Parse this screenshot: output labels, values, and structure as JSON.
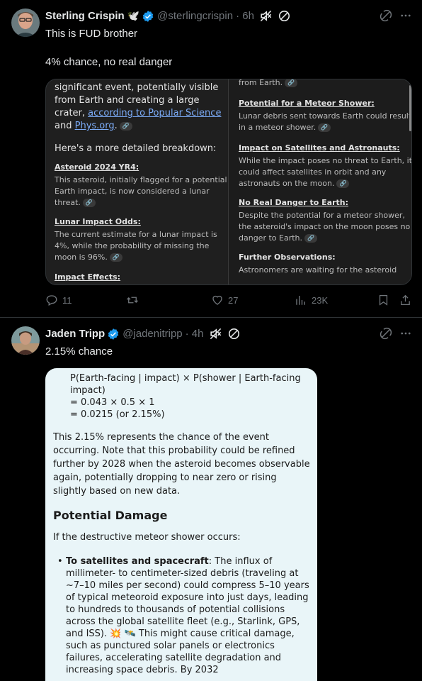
{
  "tweet1": {
    "name": "Sterling Crispin",
    "emoji": "🕊️",
    "handle": "@sterlingcrispin",
    "time": "· 6h",
    "text_line1": "This is FUD brother",
    "text_line2": "4% chance, no real danger",
    "media": {
      "left": {
        "lead_text": "significant event, potentially visible from Earth and creating a large crater,",
        "lead_link1": "according to Popular Science",
        "lead_and": " and",
        "lead_link2": "Phys.org",
        "lead_end": ".",
        "breakdown": "Here's a more detailed breakdown:",
        "s1_title": "Asteroid 2024 YR4:",
        "s1_text": "This asteroid, initially flagged for a potential Earth impact, is now considered a lunar threat.",
        "s2_title": "Lunar Impact Odds:",
        "s2_text": "The current estimate for a lunar impact is 4%, while the probability of missing the moon is 96%.",
        "s3_title": "Impact Effects:"
      },
      "right": {
        "top_text": "from Earth.",
        "r1_title": "Potential for a Meteor Shower:",
        "r1_text": "Lunar debris sent towards Earth could result in a meteor shower.",
        "r2_title": "Impact on Satellites and Astronauts:",
        "r2_text": "While the impact poses no threat to Earth, it could affect satellites in orbit and any astronauts on the moon.",
        "r3_title": "No Real Danger to Earth:",
        "r3_text": "Despite the potential for a meteor shower, the asteroid's impact on the moon poses no danger to Earth.",
        "r4_title": "Further Observations:",
        "r4_text": "Astronomers are waiting for the asteroid"
      }
    },
    "actions": {
      "replies": "11",
      "likes": "27",
      "views": "23K"
    }
  },
  "tweet2": {
    "name": "Jaden Tripp",
    "handle": "@jadenitripp",
    "time": "· 4h",
    "text": "2.15% chance",
    "media": {
      "math1": "P(Earth-facing | impact) × P(shower | Earth-facing",
      "math2": "impact)",
      "math3": "= 0.043 × 0.5 × 1",
      "math4": "= 0.0215 (or 2.15%)",
      "para": "This 2.15% represents the chance of the event occurring. Note that this probability could be refined further by 2028 when the asteroid becomes observable again, potentially dropping to near zero or rising slightly based on new data.",
      "heading": "Potential Damage",
      "intro": "If the destructive meteor shower occurs:",
      "bullet_title": "To satellites and spacecraft",
      "bullet_text": ": The influx of millimeter- to centimeter-sized debris (traveling at ~7–10 miles per second) could compress 5–10 years of typical meteoroid exposure into just days, leading to hundreds to thousands of potential collisions across the global satellite fleet (e.g., Starlink, GPS, and ISS). 💥 🛰️ This might cause critical damage, such as punctured solar panels or electronics failures, accelerating satellite degradation and increasing space debris. By 2032"
    }
  },
  "colors": {
    "accent": "#1d9bf0",
    "text": "#e7e9ea",
    "muted": "#71767b",
    "border": "#2f3336"
  }
}
